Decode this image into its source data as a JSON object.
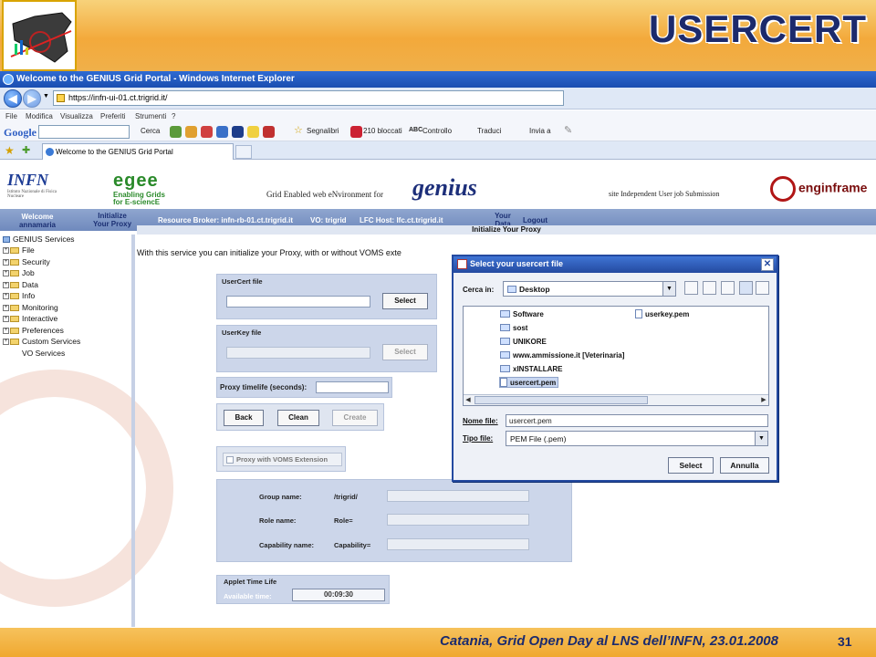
{
  "slide": {
    "title": "USERCERT",
    "footer": "Catania, Grid Open Day al LNS dell’INFN, 23.01.2008",
    "page_number": "31",
    "colors": {
      "banner": "#f3a93b",
      "title": "#1c2a6c"
    }
  },
  "browser": {
    "window_title": "Welcome to the GENIUS Grid Portal - Windows Internet Explorer",
    "address": "https://infn-ui-01.ct.trigrid.it/",
    "menu": [
      "File",
      "Modifica",
      "Visualizza",
      "Preferiti",
      "Strumenti",
      "?"
    ],
    "toolbar": {
      "google": "Google",
      "search_label": "Cerca",
      "bookmarks": "Segnalibri",
      "blocked": "210 bloccati",
      "check": "Controllo",
      "translate": "Traduci",
      "send": "Invia a"
    },
    "tab_title": "Welcome to the GENIUS Grid Portal"
  },
  "portal": {
    "infn": "INFN",
    "infn_sub": "Istituto Nazionale di Fisica Nucleare",
    "egee": "egee",
    "egee_sub1": "Enabling Grids",
    "egee_sub2": "for E-sciencE",
    "genius_line": "Grid Enabled web eNvironment for",
    "genius": "genius",
    "sius_line": "site Independent User job Submission",
    "enginframe": "enginframe",
    "nav": {
      "welcome1": "Welcome",
      "welcome2": "annamaria",
      "init1": "Initialize",
      "init2": "Your Proxy",
      "broker": "Resource Broker: infn-rb-01.ct.trigrid.it",
      "vo": "VO: trigrid",
      "lfc": "LFC Host: lfc.ct.trigrid.it",
      "yourdata1": "Your",
      "yourdata2": "Data",
      "logout": "Logout"
    },
    "tree": [
      "GENIUS Services",
      "File",
      "Security",
      "Job",
      "Data",
      "Info",
      "Monitoring",
      "Interactive",
      "Preferences",
      "Custom Services",
      "VO Services"
    ],
    "main_title": "Initialize Your Proxy",
    "intro": "With this service you can initialize your Proxy, with or without VOMS exte",
    "usercert_label": "UserCert file",
    "userkey_label": "UserKey file",
    "select": "Select",
    "proxy_lifetime": "Proxy timelife (seconds):",
    "back": "Back",
    "clean": "Clean",
    "create": "Create",
    "voms_ext": "Proxy with VOMS Extension",
    "group_name": "Group name:",
    "group_val": "/trigrid/",
    "role_name": "Role name:",
    "role_val": "Role=",
    "cap_name": "Capability name:",
    "cap_val": "Capability=",
    "applet_title": "Applet Time Life",
    "available": "Available time:",
    "time": "00:09:30"
  },
  "dialog": {
    "title": "Select your usercert file",
    "look_in": "Cerca in:",
    "folder": "Desktop",
    "files": [
      {
        "name": "Software",
        "kind": "folder"
      },
      {
        "name": "sost",
        "kind": "folder"
      },
      {
        "name": "UNIKORE",
        "kind": "folder"
      },
      {
        "name": "www.ammissione.it [Veterinaria]",
        "kind": "folder"
      },
      {
        "name": "xINSTALLARE",
        "kind": "folder"
      },
      {
        "name": "usercert.pem",
        "kind": "file",
        "selected": true
      },
      {
        "name": "userkey.pem",
        "kind": "file"
      }
    ],
    "file_name_label": "Nome file:",
    "file_name": "usercert.pem",
    "file_type_label": "Tipo file:",
    "file_type": "PEM File (.pem)",
    "select": "Select",
    "cancel": "Annulla"
  }
}
